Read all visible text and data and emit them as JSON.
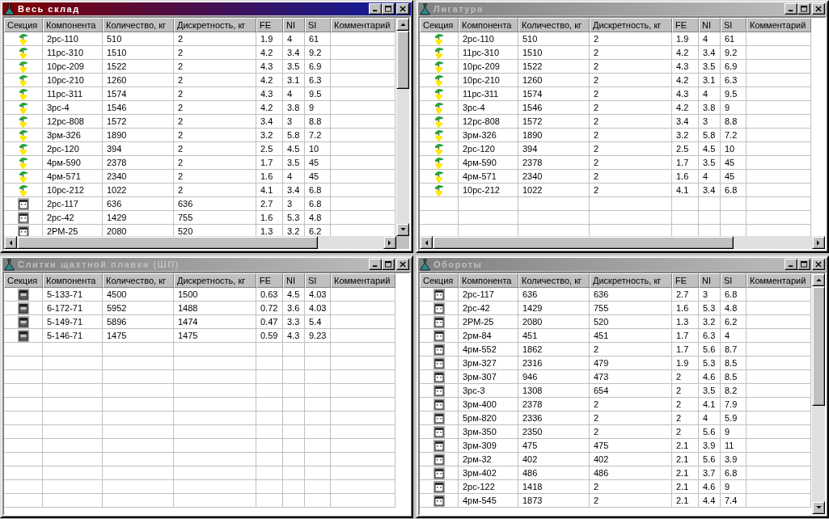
{
  "windows": [
    {
      "title": "Весь склад",
      "active": true,
      "vertical_scrollbar": true,
      "horizontal_scrollbar": true,
      "columns": [
        "Секция",
        "Компонента",
        "Количество, кг",
        "Дискретность, кг",
        "FE",
        "NI",
        "SI",
        "Комментарий"
      ],
      "rows": [
        {
          "kind": "alloy",
          "component": "2рс-110",
          "quantity": "510",
          "discreteness": "2",
          "fe": "1.9",
          "ni": "4",
          "si": "61"
        },
        {
          "kind": "alloy",
          "component": "11рс-310",
          "quantity": "1510",
          "discreteness": "2",
          "fe": "4.2",
          "ni": "3.4",
          "si": "9.2"
        },
        {
          "kind": "alloy",
          "component": "10рс-209",
          "quantity": "1522",
          "discreteness": "2",
          "fe": "4.3",
          "ni": "3.5",
          "si": "6.9"
        },
        {
          "kind": "alloy",
          "component": "10рс-210",
          "quantity": "1260",
          "discreteness": "2",
          "fe": "4.2",
          "ni": "3.1",
          "si": "6.3"
        },
        {
          "kind": "alloy",
          "component": "11рс-311",
          "quantity": "1574",
          "discreteness": "2",
          "fe": "4.3",
          "ni": "4",
          "si": "9.5"
        },
        {
          "kind": "alloy",
          "component": "3рс-4",
          "quantity": "1546",
          "discreteness": "2",
          "fe": "4.2",
          "ni": "3.8",
          "si": "9"
        },
        {
          "kind": "alloy",
          "component": "12рс-808",
          "quantity": "1572",
          "discreteness": "2",
          "fe": "3.4",
          "ni": "3",
          "si": "8.8"
        },
        {
          "kind": "alloy",
          "component": "3рм-326",
          "quantity": "1890",
          "discreteness": "2",
          "fe": "3.2",
          "ni": "5.8",
          "si": "7.2"
        },
        {
          "kind": "alloy",
          "component": "2рс-120",
          "quantity": "394",
          "discreteness": "2",
          "fe": "2.5",
          "ni": "4.5",
          "si": "10"
        },
        {
          "kind": "alloy",
          "component": "4рм-590",
          "quantity": "2378",
          "discreteness": "2",
          "fe": "1.7",
          "ni": "3.5",
          "si": "45"
        },
        {
          "kind": "alloy",
          "component": "4рм-571",
          "quantity": "2340",
          "discreteness": "2",
          "fe": "1.6",
          "ni": "4",
          "si": "45"
        },
        {
          "kind": "alloy",
          "component": "10рс-212",
          "quantity": "1022",
          "discreteness": "2",
          "fe": "4.1",
          "ni": "3.4",
          "si": "6.8"
        },
        {
          "kind": "container",
          "component": "2рс-117",
          "quantity": "636",
          "discreteness": "636",
          "fe": "2.7",
          "ni": "3",
          "si": "6.8"
        },
        {
          "kind": "container",
          "component": "2рс-42",
          "quantity": "1429",
          "discreteness": "755",
          "fe": "1.6",
          "ni": "5.3",
          "si": "4.8"
        },
        {
          "kind": "container",
          "component": "2РМ-25",
          "quantity": "2080",
          "discreteness": "520",
          "fe": "1.3",
          "ni": "3.2",
          "si": "6.2"
        }
      ]
    },
    {
      "title": "Лигатура",
      "active": false,
      "vertical_scrollbar": false,
      "horizontal_scrollbar": true,
      "columns": [
        "Секция",
        "Компонента",
        "Количество, кг",
        "Дискретность, кг",
        "FE",
        "NI",
        "SI",
        "Комментарий"
      ],
      "rows": [
        {
          "kind": "alloy",
          "component": "2рс-110",
          "quantity": "510",
          "discreteness": "2",
          "fe": "1.9",
          "ni": "4",
          "si": "61"
        },
        {
          "kind": "alloy",
          "component": "11рс-310",
          "quantity": "1510",
          "discreteness": "2",
          "fe": "4.2",
          "ni": "3.4",
          "si": "9.2"
        },
        {
          "kind": "alloy",
          "component": "10рс-209",
          "quantity": "1522",
          "discreteness": "2",
          "fe": "4.3",
          "ni": "3.5",
          "si": "6.9"
        },
        {
          "kind": "alloy",
          "component": "10рс-210",
          "quantity": "1260",
          "discreteness": "2",
          "fe": "4.2",
          "ni": "3.1",
          "si": "6.3"
        },
        {
          "kind": "alloy",
          "component": "11рс-311",
          "quantity": "1574",
          "discreteness": "2",
          "fe": "4.3",
          "ni": "4",
          "si": "9.5"
        },
        {
          "kind": "alloy",
          "component": "3рс-4",
          "quantity": "1546",
          "discreteness": "2",
          "fe": "4.2",
          "ni": "3.8",
          "si": "9"
        },
        {
          "kind": "alloy",
          "component": "12рс-808",
          "quantity": "1572",
          "discreteness": "2",
          "fe": "3.4",
          "ni": "3",
          "si": "8.8"
        },
        {
          "kind": "alloy",
          "component": "3рм-326",
          "quantity": "1890",
          "discreteness": "2",
          "fe": "3.2",
          "ni": "5.8",
          "si": "7.2"
        },
        {
          "kind": "alloy",
          "component": "2рс-120",
          "quantity": "394",
          "discreteness": "2",
          "fe": "2.5",
          "ni": "4.5",
          "si": "10"
        },
        {
          "kind": "alloy",
          "component": "4рм-590",
          "quantity": "2378",
          "discreteness": "2",
          "fe": "1.7",
          "ni": "3.5",
          "si": "45"
        },
        {
          "kind": "alloy",
          "component": "4рм-571",
          "quantity": "2340",
          "discreteness": "2",
          "fe": "1.6",
          "ni": "4",
          "si": "45"
        },
        {
          "kind": "alloy",
          "component": "10рс-212",
          "quantity": "1022",
          "discreteness": "2",
          "fe": "4.1",
          "ni": "3.4",
          "si": "6.8"
        }
      ]
    },
    {
      "title": "Слитки щахтной плавки (ШП)",
      "active": false,
      "vertical_scrollbar": false,
      "horizontal_scrollbar": false,
      "columns": [
        "Секция",
        "Компонента",
        "Количество, кг",
        "Дискретность, кг",
        "FE",
        "NI",
        "SI",
        "Комментарий"
      ],
      "rows": [
        {
          "kind": "ingot",
          "component": "5-133-71",
          "quantity": "4500",
          "discreteness": "1500",
          "fe": "0.63",
          "ni": "4.5",
          "si": "4.03"
        },
        {
          "kind": "ingot",
          "component": "6-172-71",
          "quantity": "5952",
          "discreteness": "1488",
          "fe": "0.72",
          "ni": "3.6",
          "si": "4.03"
        },
        {
          "kind": "ingot",
          "component": "5-149-71",
          "quantity": "5896",
          "discreteness": "1474",
          "fe": "0.47",
          "ni": "3.3",
          "si": "5.4"
        },
        {
          "kind": "ingot",
          "component": "5-146-71",
          "quantity": "1475",
          "discreteness": "1475",
          "fe": "0.59",
          "ni": "4.3",
          "si": "9.23"
        }
      ]
    },
    {
      "title": "Обороты",
      "active": false,
      "vertical_scrollbar": true,
      "horizontal_scrollbar": false,
      "columns": [
        "Секция",
        "Компонента",
        "Количество, кг",
        "Дискретность, кг",
        "FE",
        "NI",
        "SI",
        "Комментарий"
      ],
      "rows": [
        {
          "kind": "container",
          "component": "2рс-117",
          "quantity": "636",
          "discreteness": "636",
          "fe": "2.7",
          "ni": "3",
          "si": "6.8"
        },
        {
          "kind": "container",
          "component": "2рс-42",
          "quantity": "1429",
          "discreteness": "755",
          "fe": "1.6",
          "ni": "5.3",
          "si": "4.8"
        },
        {
          "kind": "container",
          "component": "2РМ-25",
          "quantity": "2080",
          "discreteness": "520",
          "fe": "1.3",
          "ni": "3.2",
          "si": "6.2"
        },
        {
          "kind": "container",
          "component": "2рм-84",
          "quantity": "451",
          "discreteness": "451",
          "fe": "1.7",
          "ni": "6.3",
          "si": "4"
        },
        {
          "kind": "container",
          "component": "4рм-552",
          "quantity": "1862",
          "discreteness": "2",
          "fe": "1.7",
          "ni": "5.6",
          "si": "8.7"
        },
        {
          "kind": "container",
          "component": "3рм-327",
          "quantity": "2316",
          "discreteness": "479",
          "fe": "1.9",
          "ni": "5.3",
          "si": "8.5"
        },
        {
          "kind": "container",
          "component": "3рм-307",
          "quantity": "946",
          "discreteness": "473",
          "fe": "2",
          "ni": "4.6",
          "si": "8.5"
        },
        {
          "kind": "container",
          "component": "3рс-3",
          "quantity": "1308",
          "discreteness": "654",
          "fe": "2",
          "ni": "3.5",
          "si": "8.2"
        },
        {
          "kind": "container",
          "component": "3рм-400",
          "quantity": "2378",
          "discreteness": "2",
          "fe": "2",
          "ni": "4.1",
          "si": "7.9"
        },
        {
          "kind": "container",
          "component": "5рм-820",
          "quantity": "2336",
          "discreteness": "2",
          "fe": "2",
          "ni": "4",
          "si": "5.9"
        },
        {
          "kind": "container",
          "component": "3рм-350",
          "quantity": "2350",
          "discreteness": "2",
          "fe": "2",
          "ni": "5.6",
          "si": "9"
        },
        {
          "kind": "container",
          "component": "3рм-309",
          "quantity": "475",
          "discreteness": "475",
          "fe": "2.1",
          "ni": "3.9",
          "si": "11"
        },
        {
          "kind": "container",
          "component": "2рм-32",
          "quantity": "402",
          "discreteness": "402",
          "fe": "2.1",
          "ni": "5.6",
          "si": "3.9"
        },
        {
          "kind": "container",
          "component": "3рм-402",
          "quantity": "486",
          "discreteness": "486",
          "fe": "2.1",
          "ni": "3.7",
          "si": "6.8"
        },
        {
          "kind": "container",
          "component": "2рс-122",
          "quantity": "1418",
          "discreteness": "2",
          "fe": "2.1",
          "ni": "4.6",
          "si": "9"
        },
        {
          "kind": "container",
          "component": "4рм-545",
          "quantity": "1873",
          "discreteness": "2",
          "fe": "2.1",
          "ni": "4.4",
          "si": "7.4"
        }
      ]
    }
  ]
}
